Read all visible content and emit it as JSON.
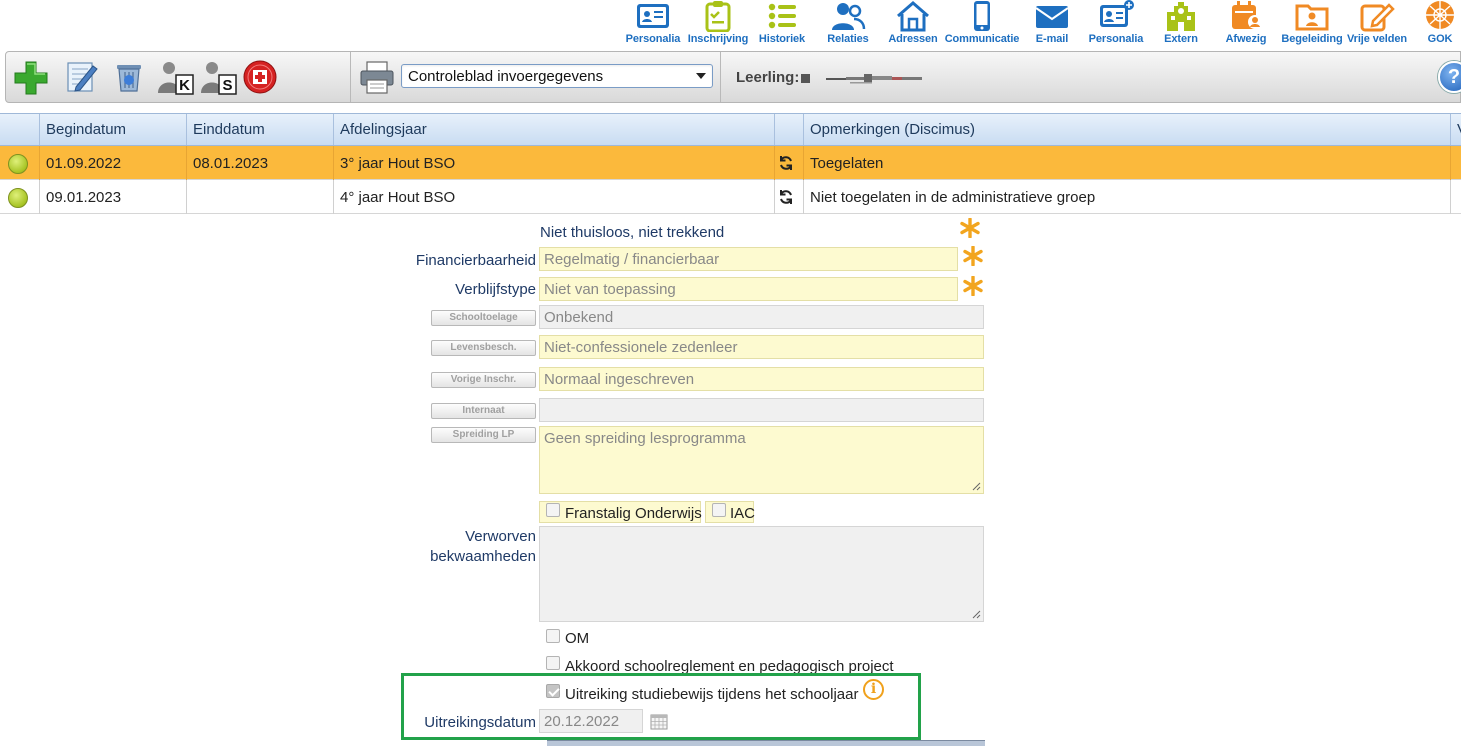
{
  "topnav": {
    "items": [
      {
        "label": "Personalia",
        "icon": "id-card-icon",
        "color": "#1e6fc0"
      },
      {
        "label": "Inschrijving",
        "icon": "clipboard-icon",
        "color": "#a9c217"
      },
      {
        "label": "Historiek",
        "icon": "list-icon",
        "color": "#a9c217"
      },
      {
        "label": "Relaties",
        "icon": "people-icon",
        "color": "#1e6fc0"
      },
      {
        "label": "Adressen",
        "icon": "house-icon",
        "color": "#1e6fc0"
      },
      {
        "label": "Communicatie",
        "icon": "phone-icon",
        "color": "#1e6fc0"
      },
      {
        "label": "E-mail",
        "icon": "envelope-icon",
        "color": "#1e6fc0"
      },
      {
        "label": "Personalia",
        "icon": "id-card-plus-icon",
        "color": "#1e6fc0"
      },
      {
        "label": "Extern",
        "icon": "school-icon",
        "color": "#a9c217"
      },
      {
        "label": "Afwezig",
        "icon": "calendar-person-icon",
        "color": "#f08a24"
      },
      {
        "label": "Begeleiding",
        "icon": "folder-person-icon",
        "color": "#f08a24"
      },
      {
        "label": "Vrije velden",
        "icon": "pencil-note-icon",
        "color": "#f08a24"
      },
      {
        "label": "GOK",
        "icon": "globe-icon",
        "color": "#f08a24"
      }
    ]
  },
  "toolbar": {
    "report_select": "Controleblad invoergegevens",
    "leerling_label": "Leerling:"
  },
  "grid": {
    "columns": [
      "",
      "Begindatum",
      "Einddatum",
      "Afdelingsjaar",
      "",
      "Opmerkingen (Discimus)",
      "V"
    ],
    "rows": [
      {
        "begindatum": "01.09.2022",
        "einddatum": "08.01.2023",
        "afdelingsjaar": "3° jaar Hout BSO",
        "opmerkingen": "Toegelaten",
        "selected": true
      },
      {
        "begindatum": "09.01.2023",
        "einddatum": "",
        "afdelingsjaar": "4° jaar Hout BSO",
        "opmerkingen": "Niet toegelaten in de administratieve groep",
        "selected": false
      }
    ]
  },
  "form": {
    "thuisloos_text": "Niet thuisloos, niet trekkend",
    "financierbaarheid_label": "Financierbaarheid",
    "financierbaarheid_value": "Regelmatig / financierbaar",
    "verblijfstype_label": "Verblijfstype",
    "verblijfstype_value": "Niet van toepassing",
    "schooltoelage_btn": "Schooltoelage",
    "schooltoelage_value": "Onbekend",
    "levensbesch_btn": "Levensbesch.",
    "levensbesch_value": "Niet-confessionele zedenleer",
    "vorige_inschr_btn": "Vorige Inschr.",
    "vorige_inschr_value": "Normaal ingeschreven",
    "internaat_btn": "Internaat",
    "internaat_value": "",
    "spreiding_btn": "Spreiding LP",
    "spreiding_value": "Geen spreiding lesprogramma",
    "franstalig_label": "Franstalig Onderwijs",
    "iac_label": "IAC",
    "verworven_label_1": "Verworven",
    "verworven_label_2": "bekwaamheden",
    "verworven_value": "",
    "om_label": "OM",
    "akkoord_label": "Akkoord schoolreglement en pedagogisch project",
    "uitreiking_label": "Uitreiking studiebewijs tijdens het schooljaar",
    "uitreiking_checked": true,
    "uitreikingsdatum_label": "Uitreikingsdatum",
    "uitreikingsdatum_value": "20.12.2022"
  }
}
